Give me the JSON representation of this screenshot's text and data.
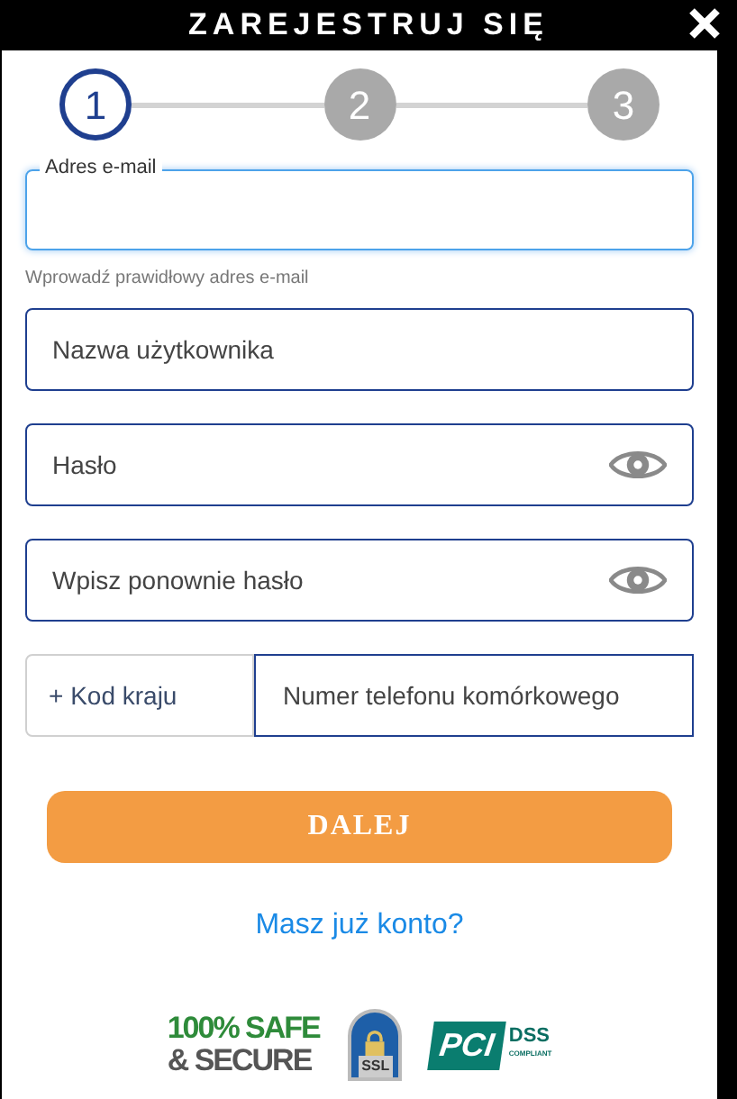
{
  "header": {
    "title": "ZAREJESTRUJ SIĘ"
  },
  "steps": [
    {
      "label": "1",
      "selected": true
    },
    {
      "label": "2",
      "selected": false
    },
    {
      "label": "3",
      "selected": false
    }
  ],
  "fields": [
    {
      "kind": "email",
      "label": "Adres e-mail",
      "hint": "Wprowadź prawidłowy adres e-mail",
      "focused": true
    },
    {
      "kind": "text",
      "placeholder": "Nazwa użytkownika"
    },
    {
      "kind": "password",
      "placeholder": "Hasło"
    },
    {
      "kind": "password",
      "placeholder": "Wpisz ponownie hasło"
    }
  ],
  "phone": {
    "country_code": "+ Kod kraju",
    "placeholder": "Numer telefonu komórkowego"
  },
  "submit": "DALEJ",
  "login_link": "Masz już konto?",
  "badges": [
    {
      "kind": "safe",
      "lines": [
        "100% SAFE",
        "& SECURE"
      ]
    },
    {
      "kind": "ssl",
      "lines": [
        "SSL"
      ]
    },
    {
      "kind": "pci",
      "lines": [
        "PCI",
        "DSS",
        "COMPLIANT"
      ]
    }
  ]
}
